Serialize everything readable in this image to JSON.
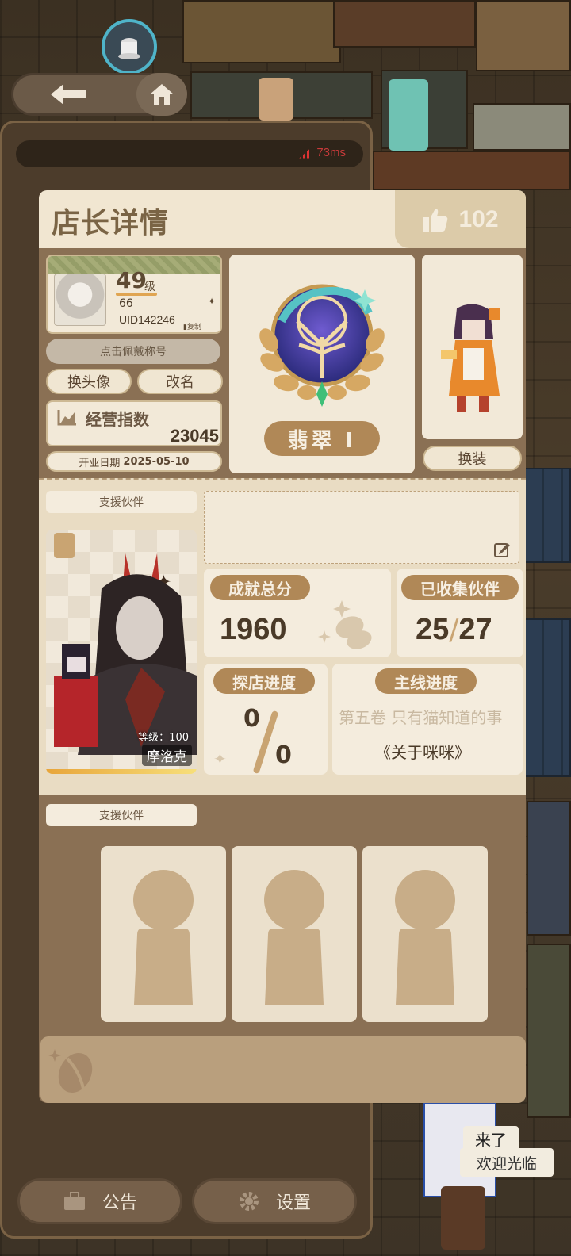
{
  "network": {
    "ping": "73ms"
  },
  "modal": {
    "title": "店长详情",
    "likes": "102"
  },
  "profile": {
    "level": "49",
    "level_unit": "级",
    "exp": "66",
    "uid": "UID142246",
    "copy_label": "复制",
    "title_wear_label": "点击佩戴称号",
    "change_avatar_label": "换头像",
    "rename_label": "改名",
    "business_index_label": "经营指数",
    "business_index_value": "23045",
    "open_date_label": "开业日期",
    "open_date_value": "2025-05-10"
  },
  "rank": {
    "name": "翡翠 Ⅰ"
  },
  "outfit": {
    "change_label": "换装"
  },
  "support": {
    "label": "支援伙伴",
    "partner_level_label": "等级：100",
    "partner_name": "摩洛克",
    "stars": "✦✦✦✦"
  },
  "stats": {
    "achievement_label": "成就总分",
    "achievement_value": "1960",
    "collected_label": "已收集伙伴",
    "collected_value": "25",
    "collected_total": "27",
    "explore_label": "探店进度",
    "explore_value": "0",
    "explore_total": "0",
    "story_label": "主线进度",
    "story_volume": "第五卷 只有猫知道的事",
    "story_chapter": "《关于咪咪》"
  },
  "support2": {
    "label": "支援伙伴"
  },
  "bottom": {
    "notice_label": "公告",
    "settings_label": "设置"
  },
  "speech": {
    "came": "来了",
    "welcome": "欢迎光临"
  },
  "colors": {
    "accent": "#b08857",
    "panel": "#f2e9d8",
    "frame": "#8a7054",
    "ping": "#c83a3a"
  }
}
